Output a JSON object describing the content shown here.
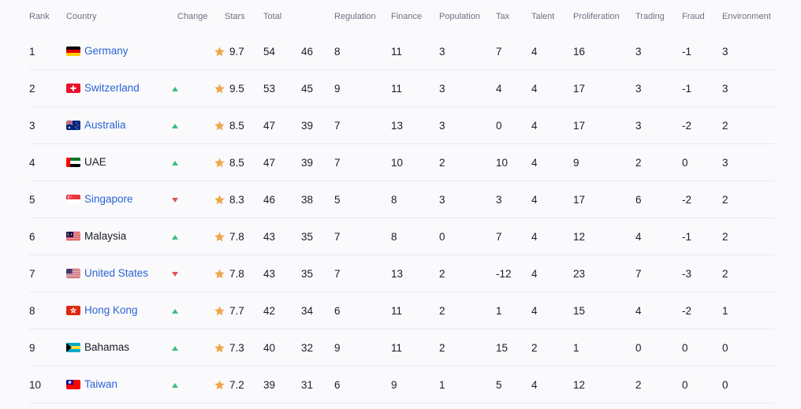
{
  "columns": {
    "rank": "Rank",
    "country": "Country",
    "change": "Change",
    "stars": "Stars",
    "total": "Total",
    "regulation": "Regulation",
    "finance": "Finance",
    "population": "Population",
    "tax": "Tax",
    "talent": "Talent",
    "proliferation": "Proliferation",
    "trading": "Trading",
    "fraud": "Fraud",
    "environment": "Environment"
  },
  "colors": {
    "link": "#2c63d6",
    "up": "#3dbd7d",
    "down": "#e05555",
    "star": "#f0a64a"
  },
  "rows": [
    {
      "rank": "1",
      "country": "Germany",
      "flag": "germany",
      "link": true,
      "change": "",
      "stars": "9.7",
      "total": "54",
      "subtotal": "46",
      "regulation": "8",
      "finance": "11",
      "population": "3",
      "tax": "7",
      "talent": "4",
      "proliferation": "16",
      "trading": "3",
      "fraud": "-1",
      "environment": "3"
    },
    {
      "rank": "2",
      "country": "Switzerland",
      "flag": "switzerland",
      "link": true,
      "change": "up",
      "stars": "9.5",
      "total": "53",
      "subtotal": "45",
      "regulation": "9",
      "finance": "11",
      "population": "3",
      "tax": "4",
      "talent": "4",
      "proliferation": "17",
      "trading": "3",
      "fraud": "-1",
      "environment": "3"
    },
    {
      "rank": "3",
      "country": "Australia",
      "flag": "australia",
      "link": true,
      "change": "up",
      "stars": "8.5",
      "total": "47",
      "subtotal": "39",
      "regulation": "7",
      "finance": "13",
      "population": "3",
      "tax": "0",
      "talent": "4",
      "proliferation": "17",
      "trading": "3",
      "fraud": "-2",
      "environment": "2"
    },
    {
      "rank": "4",
      "country": "UAE",
      "flag": "uae",
      "link": false,
      "change": "up",
      "stars": "8.5",
      "total": "47",
      "subtotal": "39",
      "regulation": "7",
      "finance": "10",
      "population": "2",
      "tax": "10",
      "talent": "4",
      "proliferation": "9",
      "trading": "2",
      "fraud": "0",
      "environment": "3"
    },
    {
      "rank": "5",
      "country": "Singapore",
      "flag": "singapore",
      "link": true,
      "change": "down",
      "stars": "8.3",
      "total": "46",
      "subtotal": "38",
      "regulation": "5",
      "finance": "8",
      "population": "3",
      "tax": "3",
      "talent": "4",
      "proliferation": "17",
      "trading": "6",
      "fraud": "-2",
      "environment": "2"
    },
    {
      "rank": "6",
      "country": "Malaysia",
      "flag": "malaysia",
      "link": false,
      "change": "up",
      "stars": "7.8",
      "total": "43",
      "subtotal": "35",
      "regulation": "7",
      "finance": "8",
      "population": "0",
      "tax": "7",
      "talent": "4",
      "proliferation": "12",
      "trading": "4",
      "fraud": "-1",
      "environment": "2"
    },
    {
      "rank": "7",
      "country": "United States",
      "flag": "usa",
      "link": true,
      "change": "down",
      "stars": "7.8",
      "total": "43",
      "subtotal": "35",
      "regulation": "7",
      "finance": "13",
      "population": "2",
      "tax": "-12",
      "talent": "4",
      "proliferation": "23",
      "trading": "7",
      "fraud": "-3",
      "environment": "2"
    },
    {
      "rank": "8",
      "country": "Hong Kong",
      "flag": "hongkong",
      "link": true,
      "change": "up",
      "stars": "7.7",
      "total": "42",
      "subtotal": "34",
      "regulation": "6",
      "finance": "11",
      "population": "2",
      "tax": "1",
      "talent": "4",
      "proliferation": "15",
      "trading": "4",
      "fraud": "-2",
      "environment": "1"
    },
    {
      "rank": "9",
      "country": "Bahamas",
      "flag": "bahamas",
      "link": false,
      "change": "up",
      "stars": "7.3",
      "total": "40",
      "subtotal": "32",
      "regulation": "9",
      "finance": "11",
      "population": "2",
      "tax": "15",
      "talent": "2",
      "proliferation": "1",
      "trading": "0",
      "fraud": "0",
      "environment": "0"
    },
    {
      "rank": "10",
      "country": "Taiwan",
      "flag": "taiwan",
      "link": true,
      "change": "up",
      "stars": "7.2",
      "total": "39",
      "subtotal": "31",
      "regulation": "6",
      "finance": "9",
      "population": "1",
      "tax": "5",
      "talent": "4",
      "proliferation": "12",
      "trading": "2",
      "fraud": "0",
      "environment": "0"
    }
  ]
}
